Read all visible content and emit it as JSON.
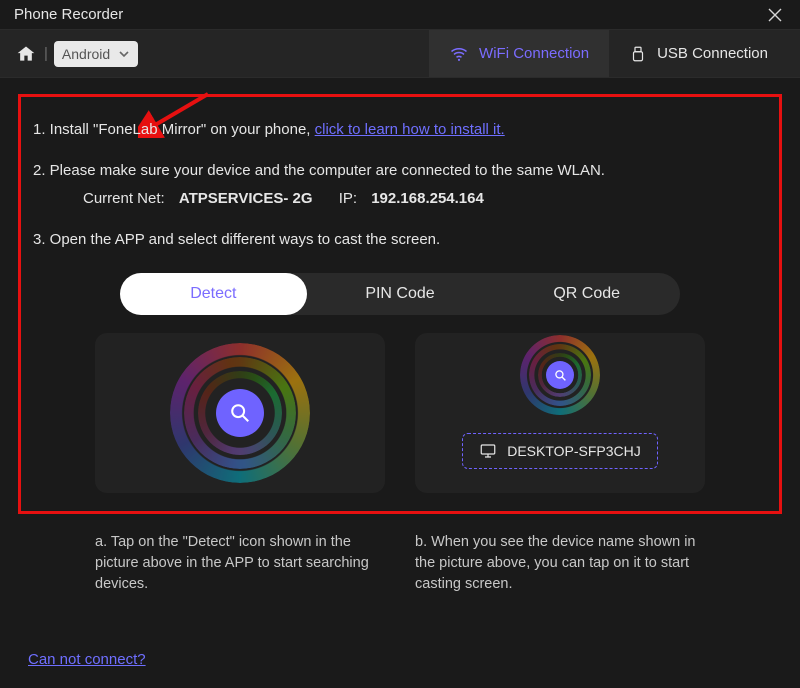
{
  "window": {
    "title": "Phone Recorder"
  },
  "toolbar": {
    "platform": "Android",
    "tabs": {
      "wifi": "WiFi Connection",
      "usb": "USB Connection"
    }
  },
  "steps": {
    "s1_prefix": "1. Install \"FoneLab Mirror\" on your phone, ",
    "s1_link": "click to learn how to install it.",
    "s2": "2. Please make sure your device and the computer are connected to the same WLAN.",
    "net_label": "Current Net:",
    "net_value": "ATPSERVICES- 2G",
    "ip_label": "IP:",
    "ip_value": "192.168.254.164",
    "s3": "3. Open the APP and select different ways to cast the screen."
  },
  "methods": {
    "detect": "Detect",
    "pin": "PIN Code",
    "qr": "QR Code"
  },
  "device": {
    "name": "DESKTOP-SFP3CHJ"
  },
  "captions": {
    "a": "a. Tap on the \"Detect\" icon shown in the picture above in the APP to start searching devices.",
    "b": "b. When you see the device name shown in the picture above, you can tap on it to start casting screen."
  },
  "footer": {
    "cannot_connect": "Can not connect?"
  }
}
